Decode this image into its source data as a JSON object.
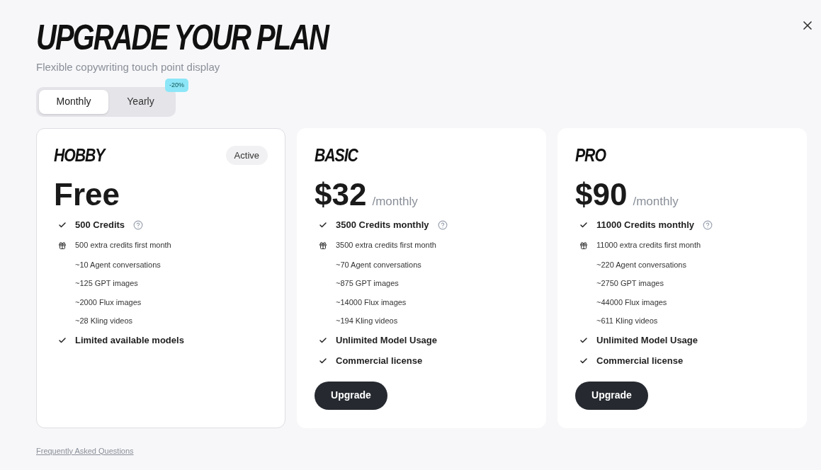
{
  "title": "UPGRADE YOUR PLAN",
  "subtitle": "Flexible copywriting touch point display",
  "billing_tabs": [
    {
      "label": "Monthly",
      "selected": true
    },
    {
      "label": "Yearly",
      "selected": false,
      "badge": "-20%"
    }
  ],
  "plans": [
    {
      "name": "HOBBY",
      "active": true,
      "status": "Active",
      "price": "Free",
      "features": [
        {
          "kind": "check",
          "text": "500 Credits",
          "help": true
        },
        {
          "kind": "gift",
          "text": "500 extra credits first month"
        },
        {
          "kind": "sub",
          "text": "~10 Agent conversations"
        },
        {
          "kind": "sub",
          "text": "~125 GPT images"
        },
        {
          "kind": "sub",
          "text": "~2000 Flux images"
        },
        {
          "kind": "sub",
          "text": "~28 Kling videos"
        },
        {
          "kind": "check",
          "text": "Limited available models"
        }
      ]
    },
    {
      "name": "BASIC",
      "active": false,
      "price": "$32",
      "period": "/monthly",
      "button": "Upgrade",
      "features": [
        {
          "kind": "check",
          "text": "3500 Credits monthly",
          "help": true
        },
        {
          "kind": "gift",
          "text": "3500 extra credits first month"
        },
        {
          "kind": "sub",
          "text": "~70 Agent conversations"
        },
        {
          "kind": "sub",
          "text": "~875 GPT images"
        },
        {
          "kind": "sub",
          "text": "~14000 Flux images"
        },
        {
          "kind": "sub",
          "text": "~194 Kling videos"
        },
        {
          "kind": "check",
          "text": "Unlimited Model Usage"
        },
        {
          "kind": "check",
          "text": "Commercial license"
        }
      ]
    },
    {
      "name": "PRO",
      "active": false,
      "price": "$90",
      "period": "/monthly",
      "button": "Upgrade",
      "features": [
        {
          "kind": "check",
          "text": "11000 Credits monthly",
          "help": true
        },
        {
          "kind": "gift",
          "text": "11000 extra credits first month"
        },
        {
          "kind": "sub",
          "text": "~220 Agent conversations"
        },
        {
          "kind": "sub",
          "text": "~2750 GPT images"
        },
        {
          "kind": "sub",
          "text": "~44000 Flux images"
        },
        {
          "kind": "sub",
          "text": "~611 Kling videos"
        },
        {
          "kind": "check",
          "text": "Unlimited Model Usage"
        },
        {
          "kind": "check",
          "text": "Commercial license"
        }
      ]
    }
  ],
  "faq_link": "Frequently Asked Questions"
}
